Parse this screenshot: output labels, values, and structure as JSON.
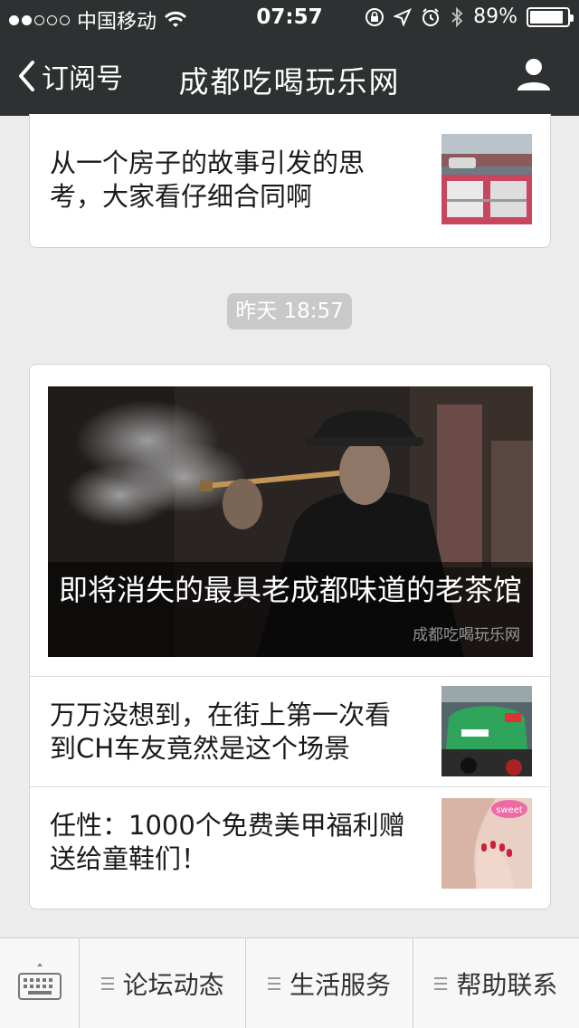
{
  "status_bar": {
    "carrier": "中国移动",
    "time": "07:57",
    "battery": "89%",
    "battery_level": 0.89
  },
  "nav": {
    "back_label": "订阅号",
    "title": "成都吃喝玩乐网"
  },
  "articles_top": [
    {
      "title": "从一个房子的故事引发的思考，大家看仔细合同啊"
    }
  ],
  "timestamp": "昨天 18:57",
  "feature": {
    "caption": "即将消失的最具老成都味道的老茶馆",
    "watermark": "成都吃喝玩乐网"
  },
  "articles": [
    {
      "title": "万万没想到，在街上第一次看到CH车友竟然是这个场景"
    },
    {
      "title": "任性：1000个免费美甲福利赠送给童鞋们！"
    }
  ],
  "menu": {
    "items": [
      "论坛动态",
      "生活服务",
      "帮助联系"
    ]
  },
  "icons": [
    "signal-dots-icon",
    "wifi-icon",
    "rotation-lock-icon",
    "location-arrow-icon",
    "alarm-icon",
    "bluetooth-icon",
    "battery-icon",
    "back-chevron-icon",
    "profile-icon",
    "keyboard-icon",
    "menu-lines-icon"
  ]
}
